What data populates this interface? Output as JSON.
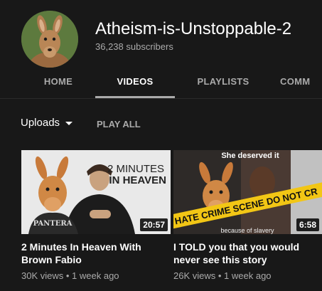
{
  "channel": {
    "name": "Atheism-is-Unstoppable-2",
    "subscribers": "36,238 subscribers"
  },
  "tabs": [
    {
      "label": "HOME"
    },
    {
      "label": "VIDEOS",
      "active": true
    },
    {
      "label": "PLAYLISTS"
    },
    {
      "label": "COMM"
    }
  ],
  "filter": {
    "uploads_label": "Uploads",
    "play_all_label": "PLAY ALL"
  },
  "videos": [
    {
      "title_line1": "2 Minutes In Heaven With",
      "title_line2": "Brown Fabio",
      "duration": "20:57",
      "views": "30K views",
      "age": "1 week ago",
      "thumb_text_1": "2 MINUTES",
      "thumb_text_2": "IN HEAVEN",
      "shirt_text": "PANTERA"
    },
    {
      "title_line1": "I TOLD you that you would",
      "title_line2": "never see this story",
      "duration": "6:58",
      "views": "26K views",
      "age": "1 week ago",
      "thumb_caption": "She deserved it",
      "tape_text": "HATE CRIME SCENE DO NOT CR",
      "thumb_bottom_text": "because of slavery"
    }
  ],
  "colors": {
    "background": "#181818",
    "tab_underline": "#aaaaaa",
    "tape": "#f2c615",
    "muted_text": "#aaaaaa"
  }
}
